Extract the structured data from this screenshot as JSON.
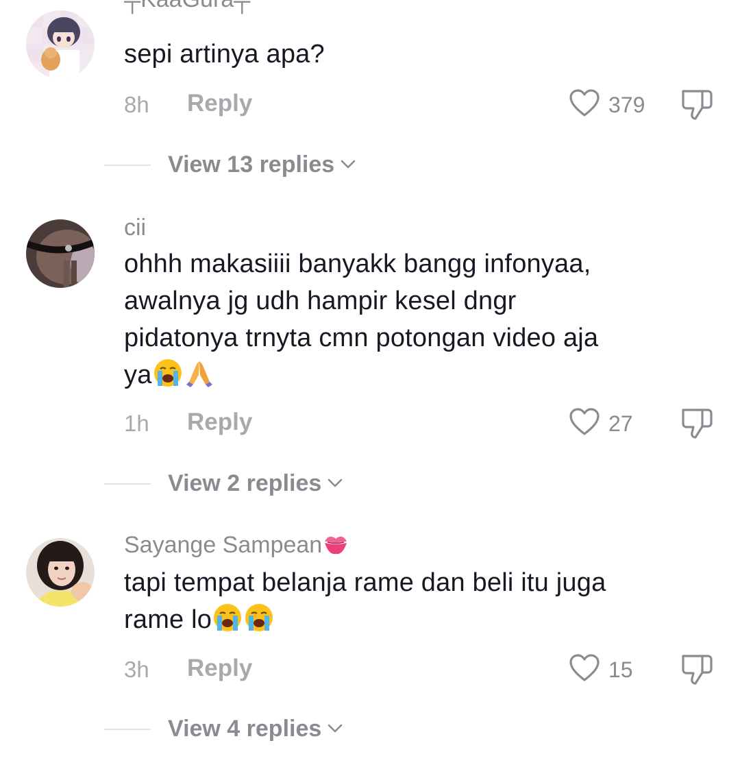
{
  "comments": [
    {
      "username": "╤KaaGura╤",
      "text": "sepi artinya apa?",
      "time": "8h",
      "reply_label": "Reply",
      "likes": "379",
      "view_replies": "View 13 replies"
    },
    {
      "username": "cii",
      "text_lines": [
        "ohhh makasiiii banyakk bangg infonyaa,",
        "awalnya jg udh hampir kesel dngr",
        "pidatonya trnyta cmn potongan video aja",
        "ya"
      ],
      "text_emojis": [
        "loudly-crying-face",
        "folded-hands"
      ],
      "time": "1h",
      "reply_label": "Reply",
      "likes": "27",
      "view_replies": "View 2 replies"
    },
    {
      "username": "Sayange Sampean",
      "username_emoji": "kiss-mark",
      "text_lines": [
        "tapi tempat belanja rame dan beli itu juga",
        "rame lo"
      ],
      "text_emojis": [
        "loudly-crying-face",
        "loudly-crying-face"
      ],
      "time": "3h",
      "reply_label": "Reply",
      "likes": "15",
      "view_replies": "View 4 replies"
    }
  ],
  "icons": {
    "like": "heart-outline-icon",
    "dislike": "thumbs-down-icon",
    "expand": "chevron-down-icon"
  },
  "colors": {
    "primary_text": "#161823",
    "secondary_text": "#8a8b91",
    "tertiary_text": "#a8a9ad",
    "divider": "#e3e3e4"
  }
}
